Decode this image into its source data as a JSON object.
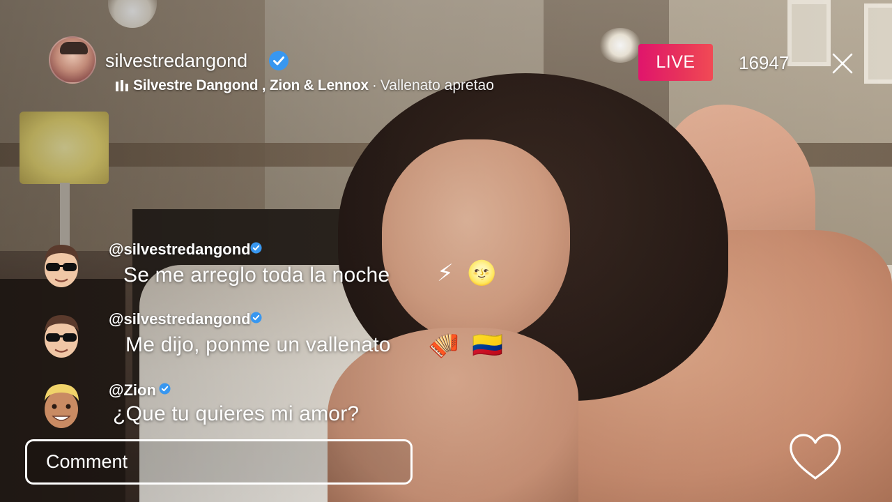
{
  "host": {
    "username": "silvestredangond",
    "verified": true
  },
  "music": {
    "artists": "Silvestre Dangond , Zion & Lennox",
    "separator": "·",
    "song": "Vallenato apretao"
  },
  "live": {
    "badge_label": "LIVE",
    "badge_color": "#e8345a",
    "viewer_count": "16947"
  },
  "comments": [
    {
      "user": "@silvestredangond",
      "verified": true,
      "text": "Se me arreglo toda la noche",
      "emojis": [
        "⚡",
        "🌝"
      ]
    },
    {
      "user": "@silvestredangond",
      "verified": true,
      "text": "Me dijo, ponme un vallenato",
      "emojis": [
        "🪗",
        "🇨🇴"
      ]
    },
    {
      "user": "@Zion",
      "verified": true,
      "text": "¿Que tu quieres mi amor?",
      "emojis": []
    }
  ],
  "comment_box": {
    "placeholder": "Comment"
  },
  "icons": {
    "close": "close-icon",
    "like": "heart-icon",
    "verified": "verified-badge-icon",
    "music": "music-bars-icon"
  }
}
